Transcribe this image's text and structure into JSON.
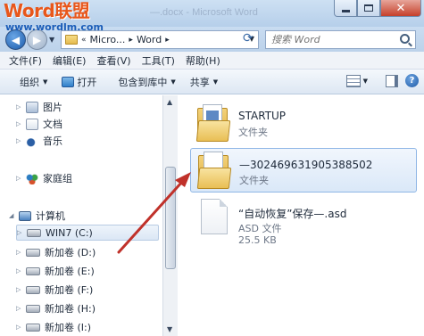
{
  "watermark": {
    "brand": "Word联盟",
    "url": "www.wordlm.com"
  },
  "window": {
    "title": "—.docx - Microsoft Word"
  },
  "address": {
    "crumbs": [
      "Micro...",
      "Word"
    ],
    "search_placeholder": "搜索 Word"
  },
  "menu": [
    "文件(F)",
    "编辑(E)",
    "查看(V)",
    "工具(T)",
    "帮助(H)"
  ],
  "toolbar": {
    "organize": "组织",
    "open": "打开",
    "include_in_library": "包含到库中",
    "share": "共享"
  },
  "nav": {
    "pictures": "图片",
    "documents": "文档",
    "music": "音乐",
    "homegroup": "家庭组",
    "computer": "计算机",
    "drives": [
      "WIN7 (C:)",
      "新加卷 (D:)",
      "新加卷 (E:)",
      "新加卷 (F:)",
      "新加卷 (H:)",
      "新加卷 (I:)"
    ]
  },
  "files": [
    {
      "name": "STARTUP",
      "type": "文件夹",
      "size": ""
    },
    {
      "name": "—302469631905388502",
      "type": "文件夹",
      "size": ""
    },
    {
      "name": "“自动恢复”保存—.asd",
      "type": "ASD 文件",
      "size": "25.5 KB"
    }
  ],
  "colors": {
    "annotation_arrow": "#c0312a",
    "watermark_brand": "#e8571b",
    "watermark_url": "#1b5db8"
  }
}
